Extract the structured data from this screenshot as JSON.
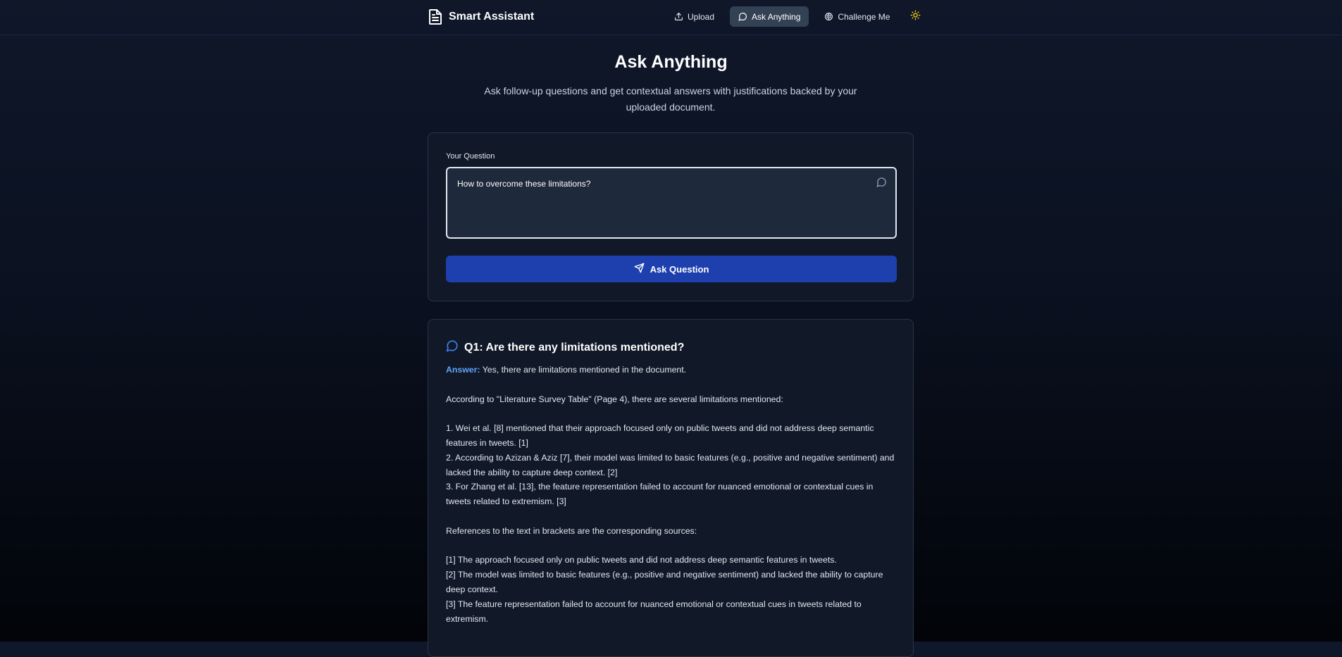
{
  "app": {
    "title": "Smart Assistant"
  },
  "nav": {
    "items": [
      {
        "label": "Upload",
        "icon": "upload-icon",
        "active": false
      },
      {
        "label": "Ask Anything",
        "icon": "chat-bubble-icon",
        "active": true
      },
      {
        "label": "Challenge Me",
        "icon": "brain-icon",
        "active": false
      }
    ],
    "theme_toggle_icon": "sun-icon"
  },
  "page": {
    "title": "Ask Anything",
    "subtitle": "Ask follow-up questions and get contextual answers with justifications backed by your uploaded document."
  },
  "question_form": {
    "label": "Your Question",
    "value": "How to overcome these limitations?",
    "button_label": "Ask Question"
  },
  "history": [
    {
      "question": "Q1: Are there any limitations mentioned?",
      "answer_label": "Answer:",
      "answer_intro": "Yes, there are limitations mentioned in the document.",
      "context": "According to \"Literature Survey Table\" (Page 4), there are several limitations mentioned:",
      "points": [
        "1. Wei et al. [8] mentioned that their approach focused only on public tweets and did not address deep semantic features in tweets. [1]",
        "2. According to Azizan & Aziz [7],  their model was limited to basic features (e.g., positive and negative sentiment) and lacked the ability to capture deep context. [2]",
        "3. For Zhang et al. [13], the feature representation failed to account for nuanced emotional or contextual cues in tweets related to extremism. [3]"
      ],
      "references_intro": "References to the text in brackets are the corresponding sources:",
      "references": [
        "[1] The approach focused only on public tweets and did not address deep semantic features in tweets.",
        "[2] The model was limited to basic features (e.g., positive and negative sentiment) and lacked the ability to capture deep context.",
        "[3] The feature representation failed to account for nuanced emotional or contextual cues in tweets related to extremism."
      ]
    }
  ],
  "colors": {
    "accent": "#1e40af",
    "answer_label": "#60a5fa",
    "sun": "#facc15"
  }
}
